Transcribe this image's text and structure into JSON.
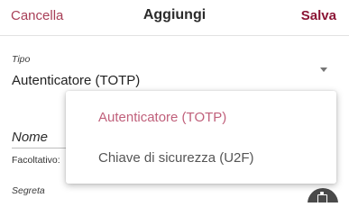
{
  "header": {
    "cancel_label": "Cancella",
    "title": "Aggiungi",
    "save_label": "Salva"
  },
  "form": {
    "type_label": "Tipo",
    "type_value": "Autenticatore (TOTP)",
    "name_placeholder": "Nome",
    "optional_hint": "Facoltativo:",
    "secret_label": "Segreta"
  },
  "type_menu": {
    "options": [
      {
        "label": "Autenticatore (TOTP)",
        "selected": true
      },
      {
        "label": "Chiave di sicurezza (U2F)",
        "selected": false
      }
    ]
  },
  "icons": {
    "dropdown": "chevron-down-icon",
    "fab": "clipboard-icon"
  },
  "colors": {
    "accent": "#8b1535",
    "cancel": "#a83e57",
    "selected_option": "#c0607b",
    "fab": "#4a4a4a"
  }
}
